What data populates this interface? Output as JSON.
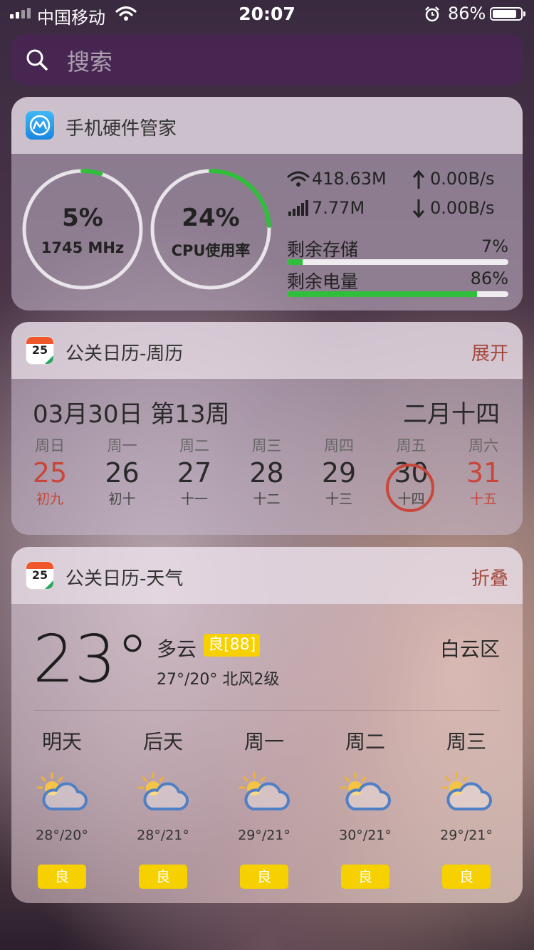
{
  "status_bar": {
    "carrier": "中国移动",
    "time": "20:07",
    "battery_percent": "86%",
    "battery_level": 0.86,
    "icons": [
      "signal-icon",
      "wifi-icon",
      "alarm-icon",
      "battery-icon"
    ]
  },
  "search": {
    "placeholder": "搜索",
    "icon": "search-icon"
  },
  "hardware": {
    "title": "手机硬件管家",
    "rings": [
      {
        "big": "5%",
        "small": "1745 MHz",
        "percent": 5
      },
      {
        "big": "24%",
        "small": "CPU使用率",
        "percent": 24
      }
    ],
    "wifi_total": "418.63M",
    "cell_total": "7.77M",
    "upload": "0.00B/s",
    "download": "0.00B/s",
    "storage_label": "剩余存储",
    "storage_value": "7%",
    "storage_percent": 7,
    "battery_label": "剩余电量",
    "battery_value": "86%",
    "battery_percent": 86,
    "colors": {
      "ring_track": "#e5e5e5",
      "ring_fill": "#2fbf3a",
      "bar_fill": "#2fbf3a"
    }
  },
  "calendar": {
    "title": "公关日历-周历",
    "icon_day": "25",
    "action": "展开",
    "date": "03月30日 第13周",
    "lunar": "二月十四",
    "days": [
      {
        "weekday": "周日",
        "day": "25",
        "lunar": "初九",
        "red": true
      },
      {
        "weekday": "周一",
        "day": "26",
        "lunar": "初十",
        "red": false
      },
      {
        "weekday": "周二",
        "day": "27",
        "lunar": "十一",
        "red": false
      },
      {
        "weekday": "周三",
        "day": "28",
        "lunar": "十二",
        "red": false
      },
      {
        "weekday": "周四",
        "day": "29",
        "lunar": "十三",
        "red": false
      },
      {
        "weekday": "周五",
        "day": "30",
        "lunar": "十四",
        "red": false,
        "today": true
      },
      {
        "weekday": "周六",
        "day": "31",
        "lunar": "十五",
        "red": true
      }
    ]
  },
  "weather": {
    "title": "公关日历-天气",
    "icon_day": "25",
    "action": "折叠",
    "temperature": "23°",
    "condition": "多云",
    "aqi": "良[88]",
    "range_wind": "27°/20° 北风2级",
    "location": "白云区",
    "forecast": [
      {
        "day": "明天",
        "temp": "28°/20°",
        "aqi": "良",
        "icon": "partly-cloudy-icon"
      },
      {
        "day": "后天",
        "temp": "28°/21°",
        "aqi": "良",
        "icon": "partly-cloudy-icon"
      },
      {
        "day": "周一",
        "temp": "29°/21°",
        "aqi": "良",
        "icon": "partly-cloudy-icon"
      },
      {
        "day": "周二",
        "temp": "30°/21°",
        "aqi": "良",
        "icon": "partly-cloudy-icon"
      },
      {
        "day": "周三",
        "temp": "29°/21°",
        "aqi": "良",
        "icon": "partly-cloudy-icon"
      }
    ]
  }
}
